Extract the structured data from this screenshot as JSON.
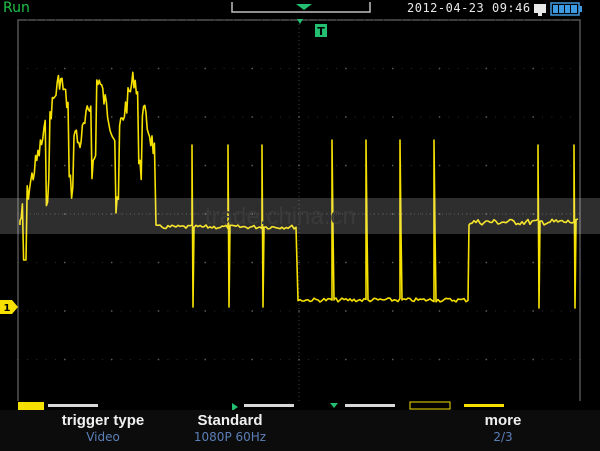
{
  "status": {
    "run_label": "Run"
  },
  "header": {
    "datetime": "2012-04-23 09:46"
  },
  "watermark": "trade.china.cn",
  "markers": {
    "trigger": "T",
    "channel": "1"
  },
  "softkeys": [
    {
      "label": "trigger type",
      "value": "Video"
    },
    {
      "label": "Standard",
      "value": "1080P 60Hz"
    },
    {
      "label": "more",
      "value": "2/3"
    }
  ],
  "colors": {
    "trace": "#f5e000",
    "run": "#1fc34a",
    "accent": "#22c070",
    "grid": "#545454"
  }
}
